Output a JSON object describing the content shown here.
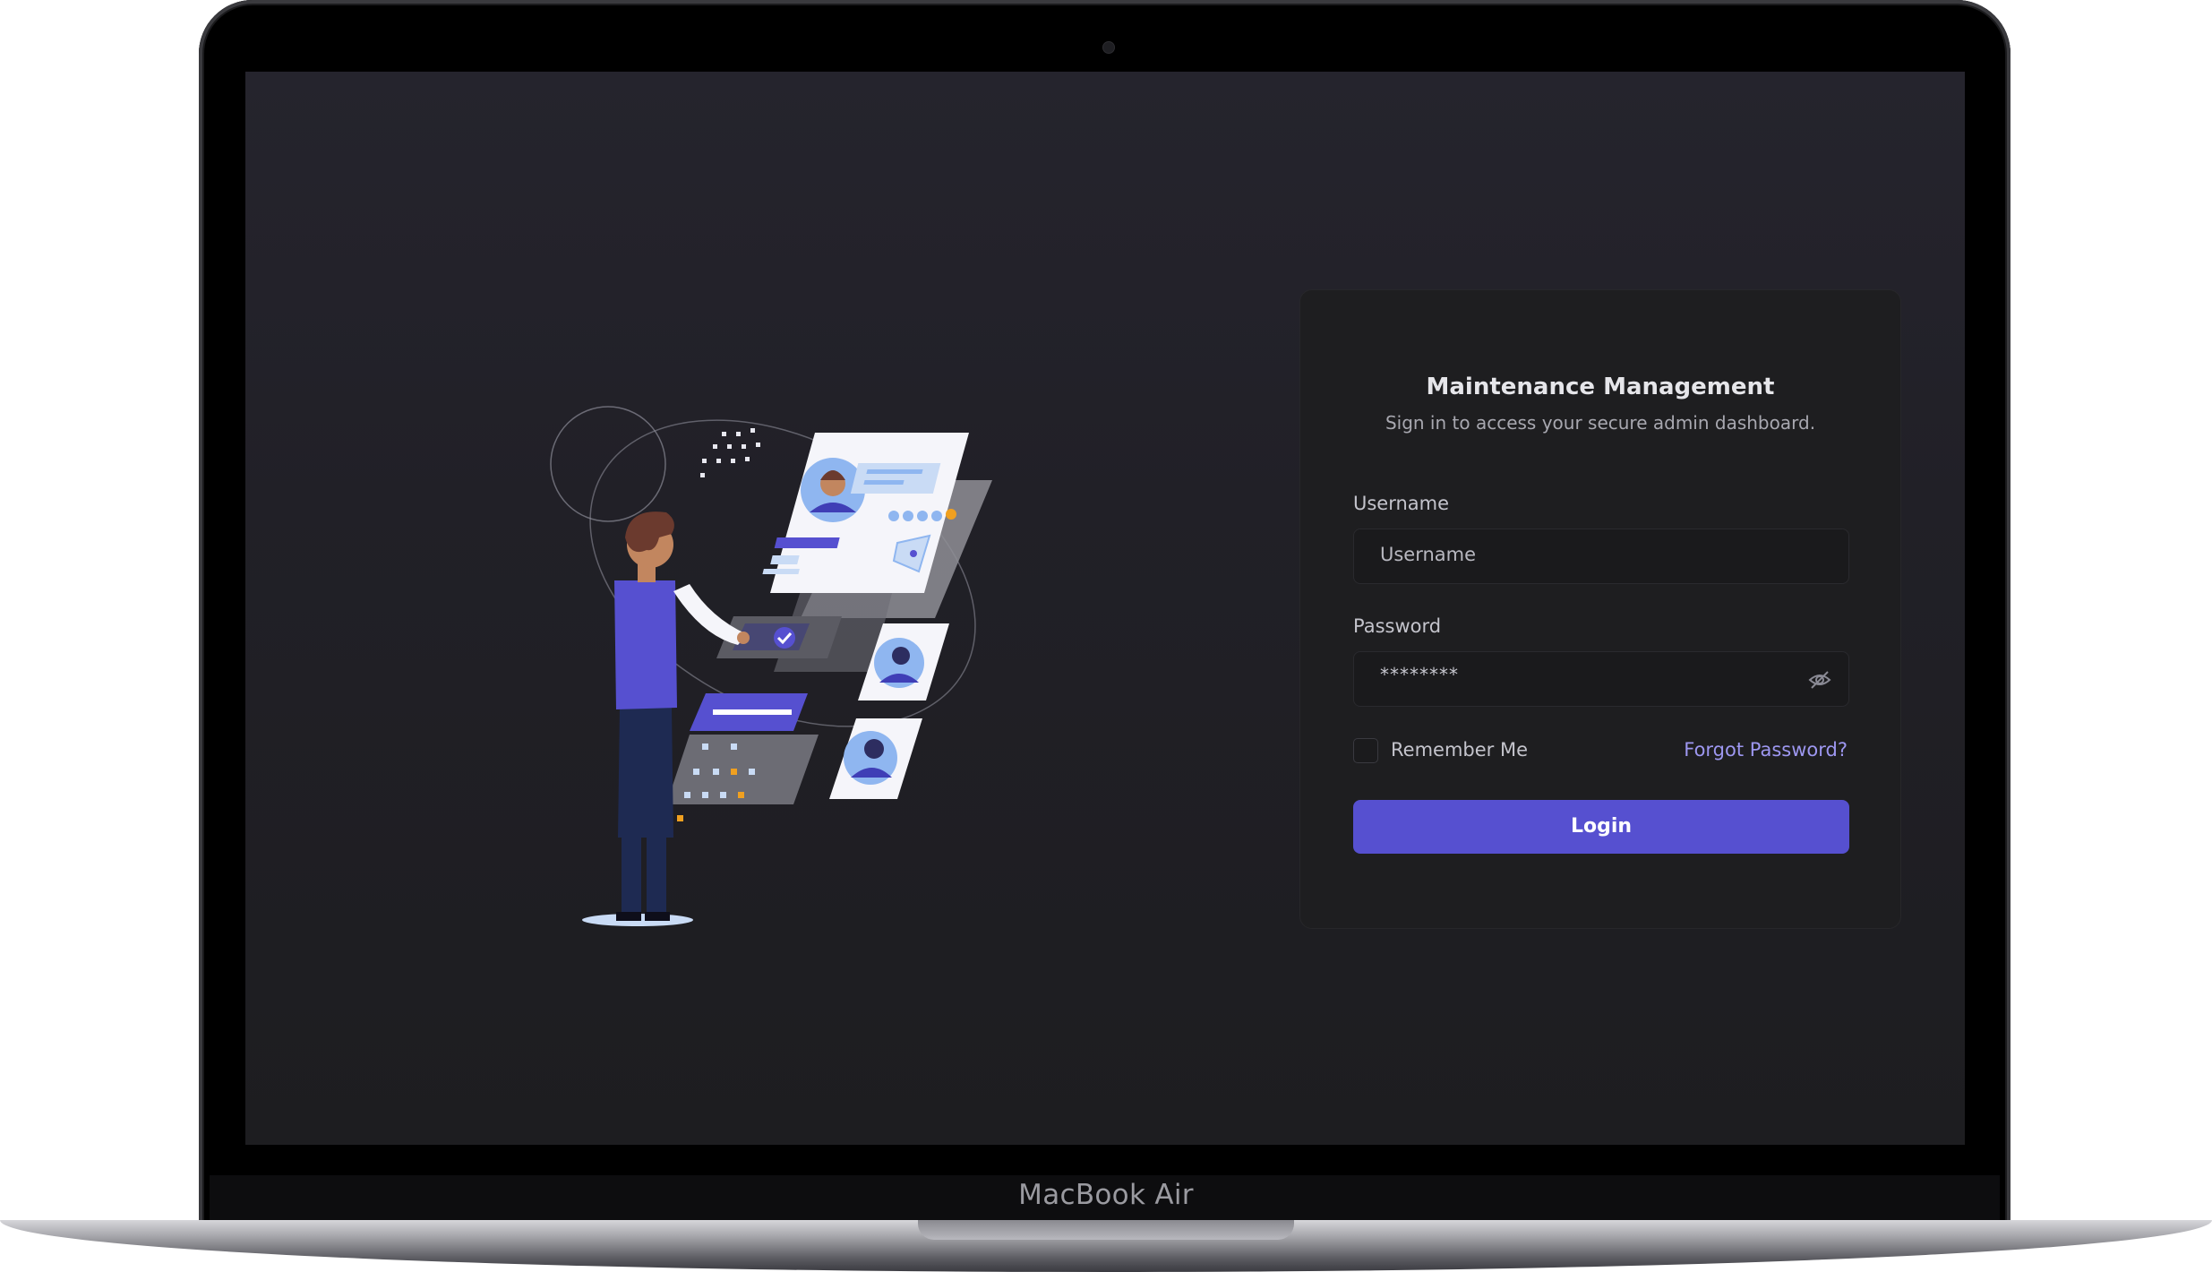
{
  "device": {
    "brand_label": "MacBook Air"
  },
  "login": {
    "title": "Maintenance Management",
    "subtitle": "Sign in to access your secure admin dashboard.",
    "username": {
      "label": "Username",
      "placeholder": "Username",
      "value": ""
    },
    "password": {
      "label": "Password",
      "masked_value": "********",
      "toggle_icon": "eye-off-icon"
    },
    "remember_me": {
      "label": "Remember Me",
      "checked": false
    },
    "forgot_password_label": "Forgot Password?",
    "login_button_label": "Login"
  },
  "colors": {
    "accent": "#5650d0",
    "link": "#9d97f0",
    "card_bg": "#1e1e20",
    "screen_bg": "#212027"
  }
}
